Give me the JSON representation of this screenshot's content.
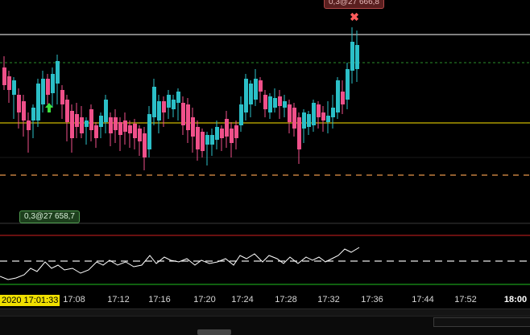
{
  "trade_badges": {
    "top_label": "0,3@27 666,8",
    "entry_label": "0,3@27 658,7"
  },
  "cursor_time": "2020 17:01:33",
  "time_axis": {
    "ticks": [
      {
        "label": "17:08",
        "bold": false
      },
      {
        "label": "17:12",
        "bold": false
      },
      {
        "label": "17:16",
        "bold": false
      },
      {
        "label": "17:20",
        "bold": false
      },
      {
        "label": "17:24",
        "bold": false
      },
      {
        "label": "17:28",
        "bold": false
      },
      {
        "label": "17:32",
        "bold": false
      },
      {
        "label": "17:36",
        "bold": false
      },
      {
        "label": "17:44",
        "bold": false
      },
      {
        "label": "17:52",
        "bold": false
      },
      {
        "label": "18:00",
        "bold": true
      }
    ]
  },
  "markers": {
    "close_icon": "close-x-icon",
    "buy_icon": "up-arrow-icon"
  },
  "colors": {
    "bull": "#2bbfc7",
    "bear": "#f0508a",
    "upper_line": "#ffffff",
    "entry_line": "#ffe600",
    "target_line": "#2a8f2a",
    "stop_line": "#e8964a",
    "osc_upper": "#d02020",
    "osc_lower": "#20c020",
    "buy_arrow": "#3ce03c",
    "close_marker": "#ff5b5b"
  }
}
